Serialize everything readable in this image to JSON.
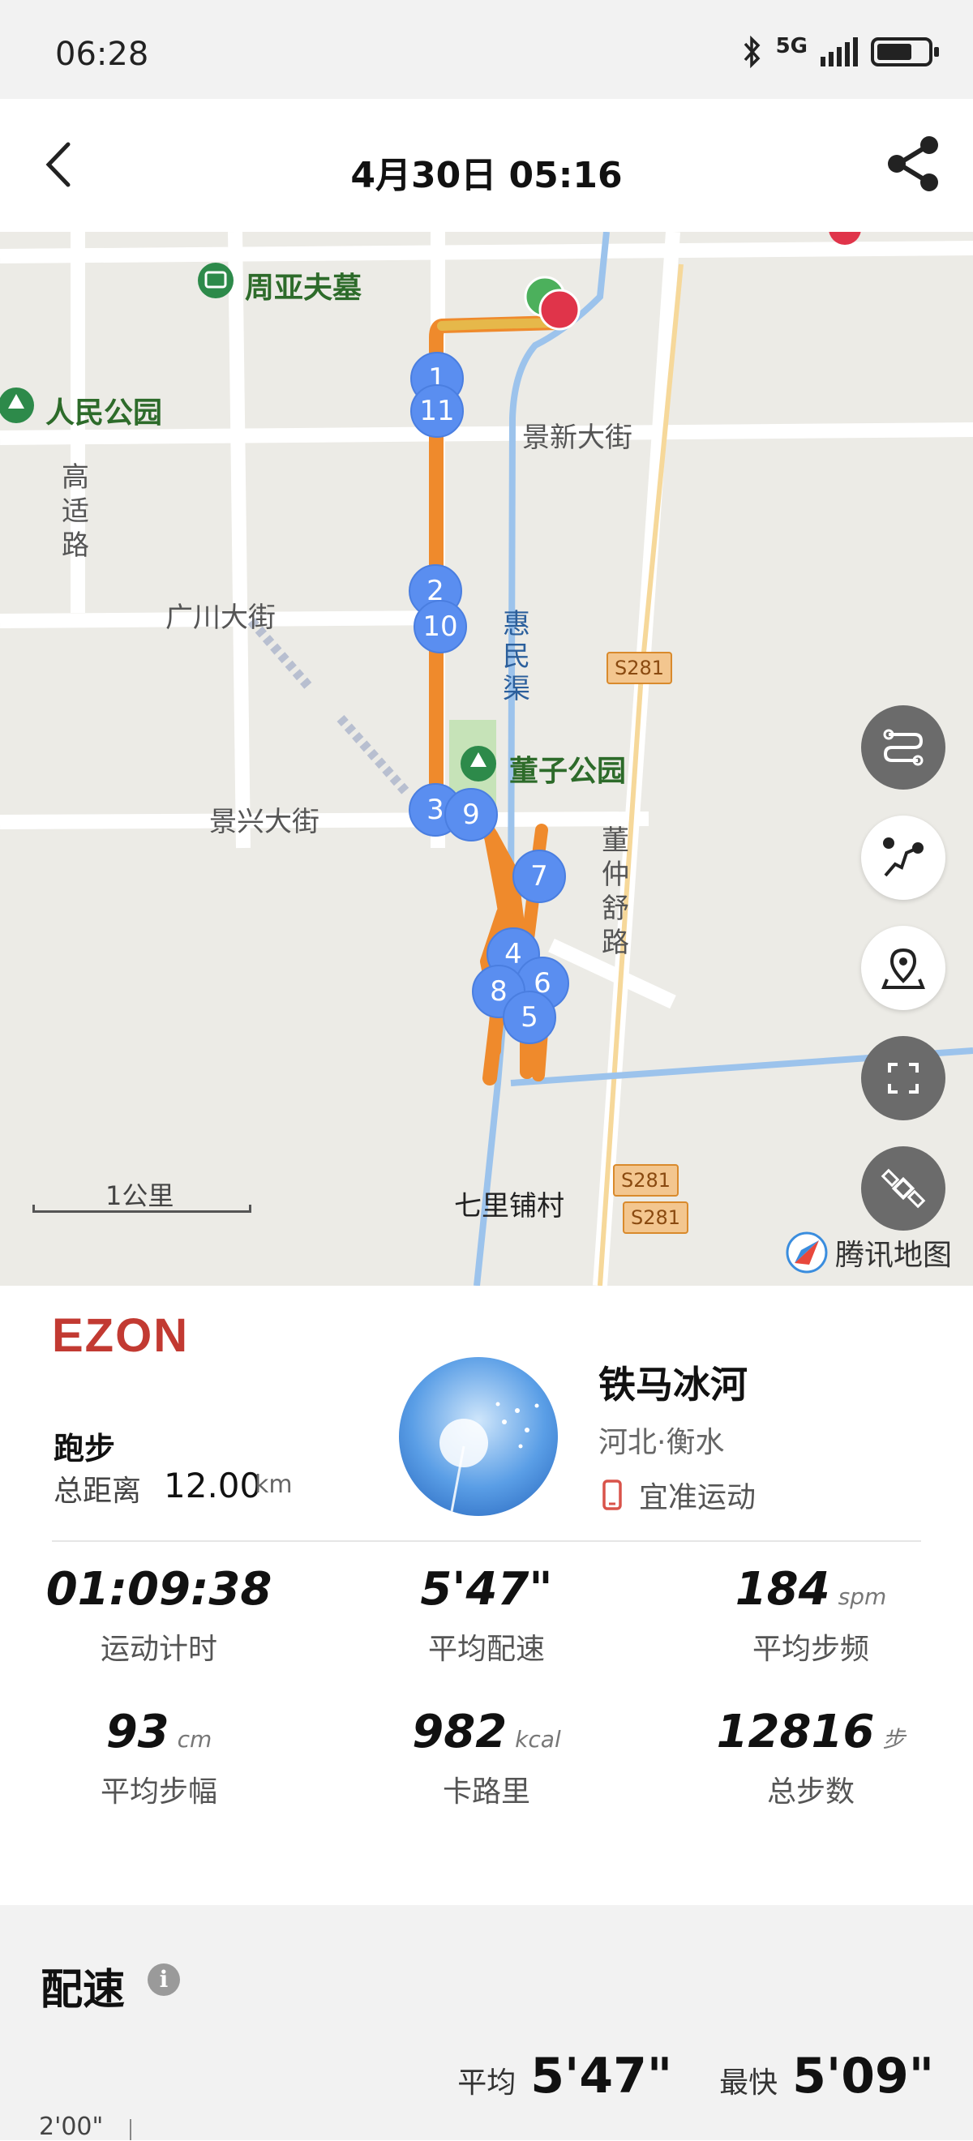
{
  "status_bar": {
    "time": "06:28",
    "network": "5G",
    "battery_level": 0.7
  },
  "header": {
    "title": "4月30日  05:16"
  },
  "map": {
    "labels": {
      "poi_tomb": "周亚夫墓",
      "poi_people_park": "人民公园",
      "poi_dongzi_park": "董子公园",
      "street_jingxin": "景新大街",
      "street_gaoshi": "高适路",
      "street_guangchuan": "广川大街",
      "street_jingxing": "景兴大街",
      "canal_huimin": "惠民渠",
      "road_dongzhongshu": "董仲舒路",
      "village_qilipu": "七里铺村",
      "road_s281_a": "S281",
      "road_s281_b": "S281",
      "road_s281_c": "S281"
    },
    "km_markers": [
      "1",
      "11",
      "2",
      "10",
      "3",
      "9",
      "7",
      "4",
      "6",
      "8",
      "5"
    ],
    "scale_label": "1公里",
    "provider": "腾讯地图",
    "controls": [
      "route-style",
      "split-route",
      "location",
      "fullscreen",
      "satellite"
    ],
    "colors": {
      "route": "#ef8a2c",
      "route_start": "#4cb05c",
      "route_end": "#e0344a",
      "marker": "#5a8ef0",
      "water": "#9cc3ec",
      "park": "#c6e3b8"
    }
  },
  "summary": {
    "brand": "EZON",
    "sport_type": "跑步",
    "distance_label": "总距离",
    "distance_value": "12.00",
    "distance_unit": "km",
    "user_name": "铁马冰河",
    "user_location": "河北·衡水",
    "device_name": "宜准运动",
    "stats": [
      {
        "value": "01:09:38",
        "unit": "",
        "label": "运动计时"
      },
      {
        "value": "5'47\"",
        "unit": "",
        "label": "平均配速"
      },
      {
        "value": "184",
        "unit": "spm",
        "label": "平均步频"
      },
      {
        "value": "93",
        "unit": "cm",
        "label": "平均步幅"
      },
      {
        "value": "982",
        "unit": "kcal",
        "label": "卡路里"
      },
      {
        "value": "12816",
        "unit": "步",
        "label": "总步数"
      }
    ]
  },
  "pace": {
    "title": "配速",
    "avg_label": "平均",
    "avg_value": "5'47\"",
    "best_label": "最快",
    "best_value": "5'09\"",
    "axis_top": "2'00\""
  }
}
